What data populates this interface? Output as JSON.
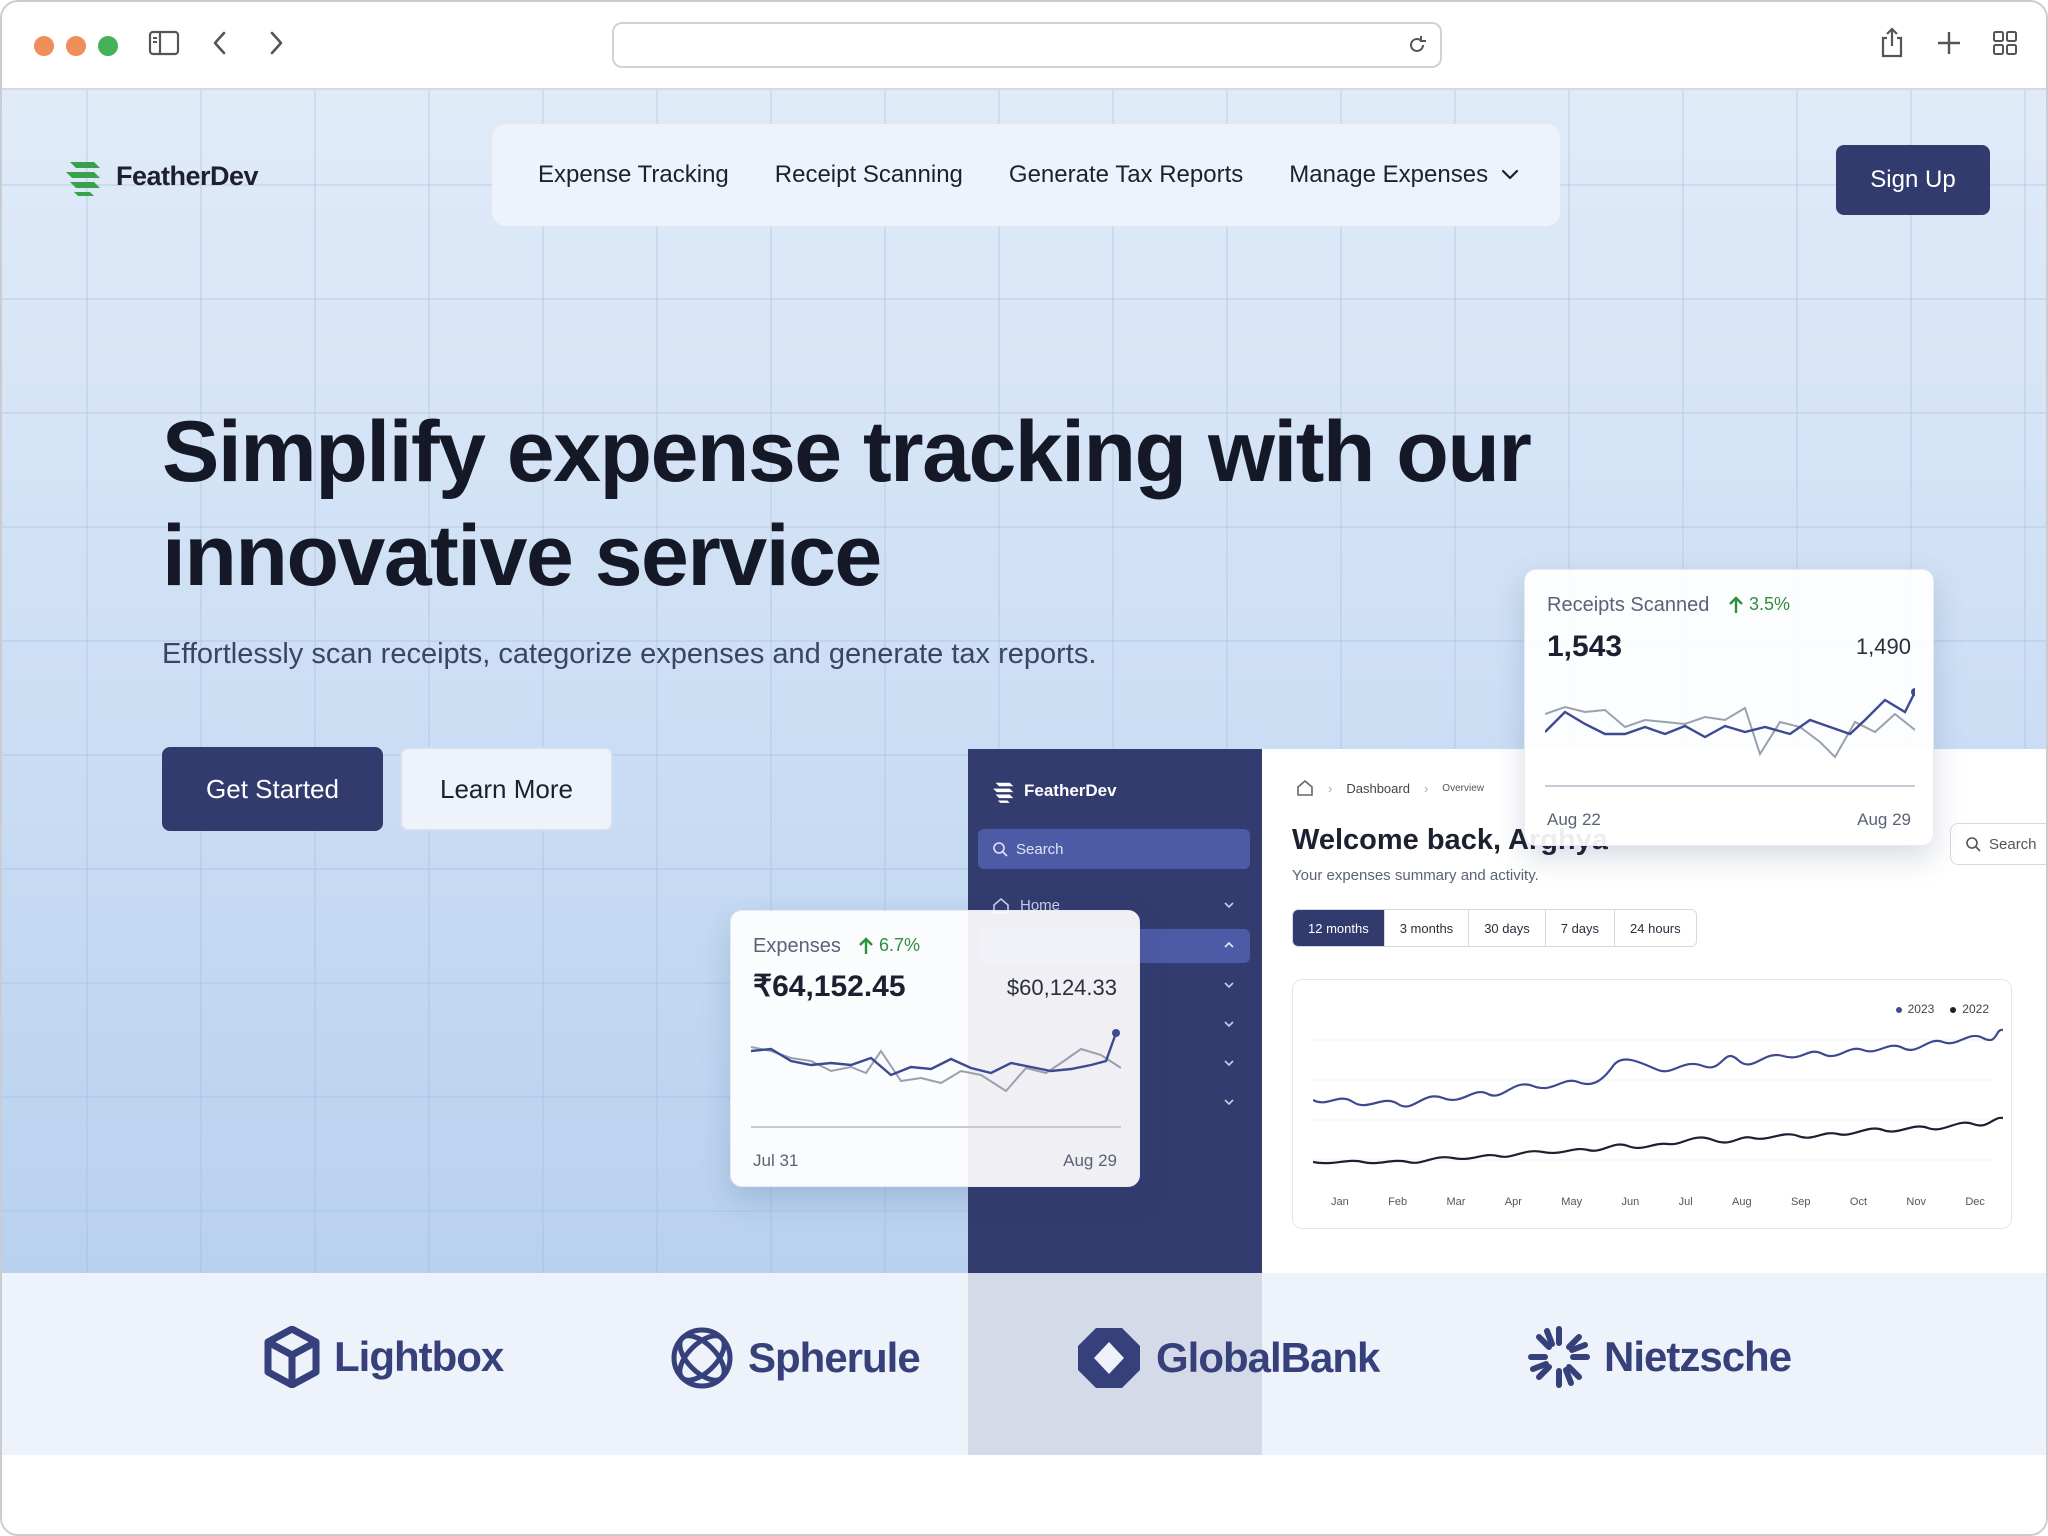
{
  "header": {
    "brand": "FeatherDev",
    "nav": [
      "Expense Tracking",
      "Receipt Scanning",
      "Generate Tax Reports",
      "Manage Expenses"
    ],
    "signup_label": "Sign Up"
  },
  "hero": {
    "headline_line1": "Simplify expense tracking with our",
    "headline_line2": "innovative service",
    "subtitle": "Effortlessly scan receipts, categorize expenses and generate tax reports.",
    "primary_cta": "Get Started",
    "secondary_cta": "Learn More"
  },
  "dashboard": {
    "brand": "FeatherDev",
    "search_placeholder": "Search",
    "sidebar_first_item": "Home",
    "breadcrumb": [
      "Dashboard",
      "Overview"
    ],
    "welcome": "Welcome back, Arghya",
    "welcome_sub": "Your expenses summary and activity.",
    "search_label": "Search",
    "tabs": [
      "12 months",
      "3 months",
      "30 days",
      "7 days",
      "24 hours"
    ],
    "legend": [
      "2023",
      "2022"
    ],
    "months": [
      "Jan",
      "Feb",
      "Mar",
      "Apr",
      "May",
      "Jun",
      "Jul",
      "Aug",
      "Sep",
      "Oct",
      "Nov",
      "Dec"
    ]
  },
  "receipts_card": {
    "label": "Receipts Scanned",
    "trend": "3.5%",
    "value": "1,543",
    "compare": "1,490",
    "start": "Aug 22",
    "end": "Aug 29"
  },
  "expenses_card": {
    "label": "Expenses",
    "trend": "6.7%",
    "value": "₹64,152.45",
    "compare": "$60,124.33",
    "start": "Jul 31",
    "end": "Aug 29"
  },
  "partners": [
    "Lightbox",
    "Spherule",
    "GlobalBank",
    "Nietzsche"
  ],
  "colors": {
    "primary": "#323b6e",
    "accent_green": "#2f8f3e",
    "hero_bg": "#cfe0f5"
  }
}
